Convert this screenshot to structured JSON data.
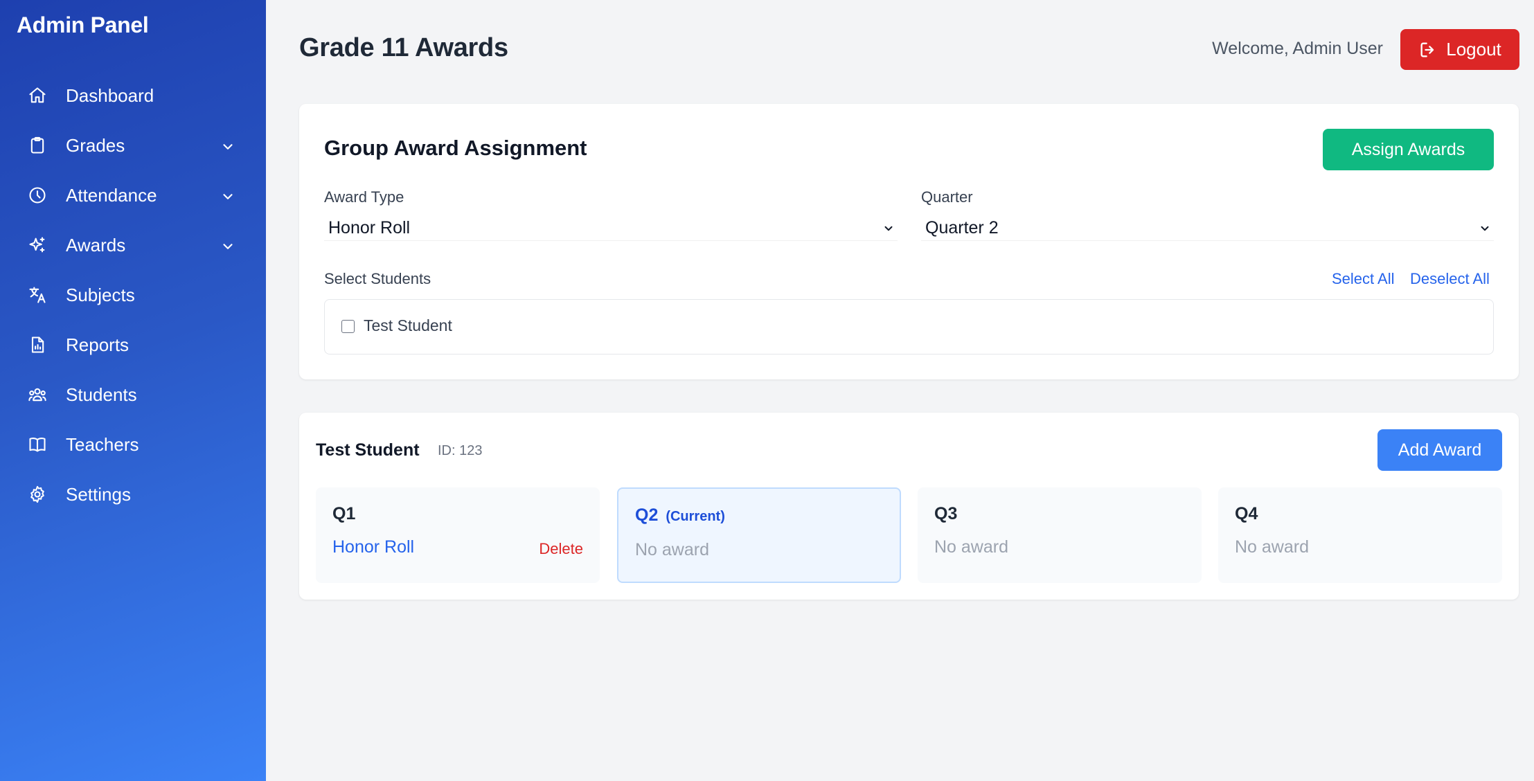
{
  "sidebar": {
    "brand": "Admin Panel",
    "items": [
      {
        "label": "Dashboard",
        "icon": "home-icon",
        "has_submenu": false
      },
      {
        "label": "Grades",
        "icon": "clipboard-icon",
        "has_submenu": true
      },
      {
        "label": "Attendance",
        "icon": "clock-icon",
        "has_submenu": true
      },
      {
        "label": "Awards",
        "icon": "sparkles-icon",
        "has_submenu": true
      },
      {
        "label": "Subjects",
        "icon": "translate-icon",
        "has_submenu": false
      },
      {
        "label": "Reports",
        "icon": "report-icon",
        "has_submenu": false
      },
      {
        "label": "Students",
        "icon": "users-icon",
        "has_submenu": false
      },
      {
        "label": "Teachers",
        "icon": "book-icon",
        "has_submenu": false
      },
      {
        "label": "Settings",
        "icon": "gear-icon",
        "has_submenu": false
      }
    ]
  },
  "header": {
    "title": "Grade 11 Awards",
    "welcome": "Welcome, Admin User",
    "logout_label": "Logout"
  },
  "group_assignment": {
    "title": "Group Award Assignment",
    "assign_button": "Assign Awards",
    "award_type_label": "Award Type",
    "award_type_value": "Honor Roll",
    "quarter_label": "Quarter",
    "quarter_value": "Quarter 2",
    "select_students_label": "Select Students",
    "select_all": "Select All",
    "deselect_all": "Deselect All",
    "students": [
      {
        "name": "Test Student",
        "checked": false
      }
    ]
  },
  "student_card": {
    "name": "Test Student",
    "id_text": "ID: 123",
    "add_award_button": "Add Award",
    "quarters": [
      {
        "label": "Q1",
        "award": "Honor Roll",
        "delete_label": "Delete",
        "current": false
      },
      {
        "label": "Q2",
        "current_tag": "(Current)",
        "empty_text": "No award",
        "current": true
      },
      {
        "label": "Q3",
        "empty_text": "No award",
        "current": false
      },
      {
        "label": "Q4",
        "empty_text": "No award",
        "current": false
      }
    ]
  },
  "colors": {
    "sidebar_start": "#1e40af",
    "sidebar_end": "#3b82f6",
    "logout": "#dc2626",
    "assign": "#10b981",
    "add_award": "#3b82f6",
    "link": "#2563eb"
  }
}
